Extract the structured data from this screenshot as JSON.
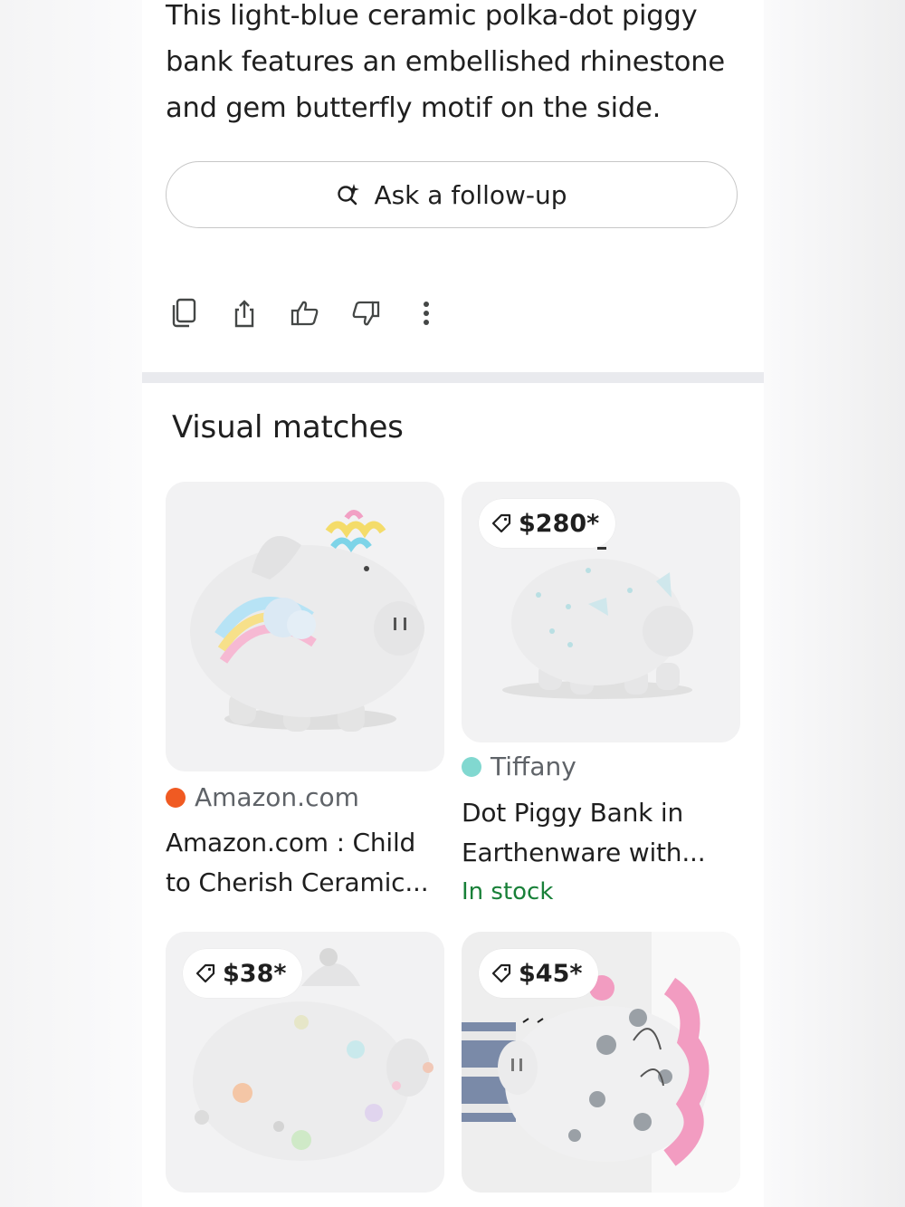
{
  "summary": {
    "text": "This light-blue ceramic polka-dot piggy bank features an embellished rhinestone and gem butterfly motif on the side."
  },
  "followup": {
    "label": "Ask a follow-up"
  },
  "actions": [
    "copy-icon",
    "share-icon",
    "thumbs-up-icon",
    "thumbs-down-icon",
    "more-vert-icon"
  ],
  "section": {
    "title": "Visual matches"
  },
  "matches": [
    {
      "source": "Amazon.com",
      "source_color": "#f05a22",
      "title_line1": "Amazon.com : Child",
      "title_line2": "to Cherish Ceramic..."
    },
    {
      "price": "$280*",
      "source": "Tiffany",
      "source_color": "#81d8d0",
      "title_line1": "Dot Piggy Bank in",
      "title_line2": "Earthenware with...",
      "stock": "In stock"
    },
    {
      "price": "$38*"
    },
    {
      "price": "$45*"
    }
  ]
}
